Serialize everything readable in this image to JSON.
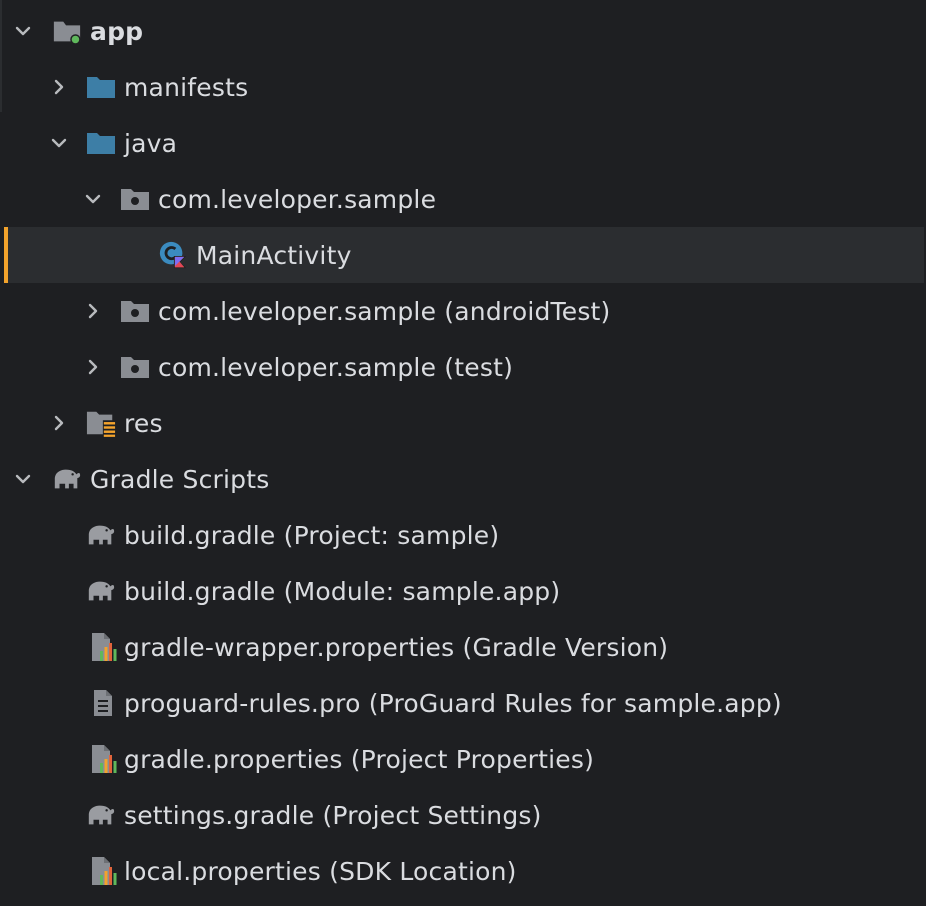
{
  "tree": {
    "app": "app",
    "manifests": "manifests",
    "java": "java",
    "pkg_main": "com.leveloper.sample",
    "main_activity": "MainActivity",
    "pkg_android_test": "com.leveloper.sample (androidTest)",
    "pkg_test": "com.leveloper.sample (test)",
    "res": "res",
    "gradle_scripts": "Gradle Scripts",
    "build_gradle_project": "build.gradle (Project: sample)",
    "build_gradle_module": "build.gradle (Module: sample.app)",
    "gradle_wrapper": "gradle-wrapper.properties (Gradle Version)",
    "proguard": "proguard-rules.pro (ProGuard Rules for sample.app)",
    "gradle_properties": "gradle.properties (Project Properties)",
    "settings_gradle": "settings.gradle (Project Settings)",
    "local_properties": "local.properties (SDK Location)"
  },
  "colors": {
    "background": "#1e1f22",
    "selected_row": "#2b2d30",
    "selection_accent": "#f3a32c",
    "folder_blue": "#3d7ea6",
    "folder_gray": "#8a8d93",
    "module_dot": "#5fb85c"
  },
  "icons": {
    "expanded": "chevron-down-icon",
    "collapsed": "chevron-right-icon",
    "module": "module-folder-icon",
    "source_folder": "source-folder-icon",
    "package": "package-icon",
    "kotlin_class": "kotlin-class-icon",
    "resources": "resources-folder-icon",
    "gradle": "gradle-elephant-icon",
    "properties": "properties-file-icon",
    "text_file": "text-file-icon"
  }
}
